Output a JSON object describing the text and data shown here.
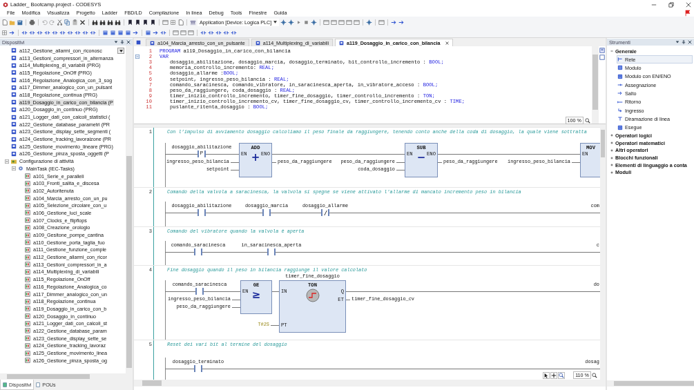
{
  "window": {
    "title": "Ladder_ Bootcamp.project - CODESYS"
  },
  "menu": [
    "File",
    "Modifica",
    "Visualizza",
    "Progetto",
    "Ladder",
    "FBD/LD",
    "Compilazione",
    "In linea",
    "Debug",
    "Tools",
    "Finestre",
    "Guida"
  ],
  "toolbar": {
    "application": "Application [Device: Logica PLC]"
  },
  "devices": {
    "title": "Dispositivi",
    "tree": [
      {
        "label": "a112_Gestione_allarmi_con_riconosc",
        "kind": "pou",
        "selected": false
      },
      {
        "label": "a113_Gestioni_compressori_in_alternanza",
        "kind": "pou",
        "selected": false
      },
      {
        "label": "a114_Multiplexing_di_variabili (PRG)",
        "kind": "pou",
        "selected": false
      },
      {
        "label": "a115_Regolazione_OnOff (PRG)",
        "kind": "pou",
        "selected": false
      },
      {
        "label": "a116_Regolazione_Analogica_con_3_sog",
        "kind": "pou",
        "selected": false
      },
      {
        "label": "a117_Dimmer_analogico_con_un_pulsant",
        "kind": "pou",
        "selected": false
      },
      {
        "label": "a118_Regolazione_continua (PRG)",
        "kind": "pou",
        "selected": false
      },
      {
        "label": "a119_Dosaggio_in_carico_con_bilancia (P",
        "kind": "pou",
        "selected": true
      },
      {
        "label": "a120_Dosaggio_in_continuo (PRG)",
        "kind": "pou",
        "selected": false
      },
      {
        "label": "a121_Logger_dati_con_calcoli_statistici (",
        "kind": "pou",
        "selected": false
      },
      {
        "label": "a122_Gestione_database_parametri (PR",
        "kind": "pou",
        "selected": false
      },
      {
        "label": "a123_Gestione_display_sette_segmenti (",
        "kind": "pou",
        "selected": false
      },
      {
        "label": "a124_Gestione_tracking_lavoraizone (PR",
        "kind": "pou",
        "selected": false
      },
      {
        "label": "a125_Gestione_movimento_lineare (PRG)",
        "kind": "pou",
        "selected": false
      },
      {
        "label": "a126_Gestione_pinza_sposta_oggetti (P",
        "kind": "pou",
        "selected": false
      },
      {
        "label": "Configurazione di attività",
        "kind": "task-config",
        "selected": false,
        "expanded": true,
        "children": [
          {
            "label": "MainTask (IEC-Tasks)",
            "kind": "task",
            "selected": false,
            "expanded": true,
            "children": [
              {
                "label": "a101_Serie_e_paralleli",
                "kind": "call",
                "selected": false
              },
              {
                "label": "a103_Fronti_salita_e_discesa",
                "kind": "call",
                "selected": false
              },
              {
                "label": "a102_Autoritenuta",
                "kind": "call",
                "selected": false
              },
              {
                "label": "a104_Marcia_arresto_con_un_pu",
                "kind": "call",
                "selected": false
              },
              {
                "label": "a105_Selezione_circolare_con_u",
                "kind": "call",
                "selected": false
              },
              {
                "label": "a106_Gestione_luci_scale",
                "kind": "call",
                "selected": false
              },
              {
                "label": "a107_Clocks_e_flipflops",
                "kind": "call",
                "selected": false
              },
              {
                "label": "a108_Creazione_orologio",
                "kind": "call",
                "selected": false
              },
              {
                "label": "a109_Gesitone_pompe_cantina",
                "kind": "call",
                "selected": false
              },
              {
                "label": "a110_Gestione_porta_taglia_fuo",
                "kind": "call",
                "selected": false
              },
              {
                "label": "a111_Gestione_funzione_comple",
                "kind": "call",
                "selected": false
              },
              {
                "label": "a112_Gestione_allarmi_con_ricor",
                "kind": "call",
                "selected": false
              },
              {
                "label": "a113_Gestioni_compressori_in_a",
                "kind": "call",
                "selected": false
              },
              {
                "label": "a114_Multiplexing_di_variabili",
                "kind": "call",
                "selected": false
              },
              {
                "label": "a115_Regolazione_OnOff",
                "kind": "call",
                "selected": false
              },
              {
                "label": "a116_Regolazione_Analogica_co",
                "kind": "call",
                "selected": false
              },
              {
                "label": "a117_Dimmer_analogico_con_un",
                "kind": "call",
                "selected": false
              },
              {
                "label": "a118_Regolazione_continua",
                "kind": "call",
                "selected": false
              },
              {
                "label": "a119_Dosaggio_in_carico_con_b",
                "kind": "call",
                "selected": false
              },
              {
                "label": "a120_Dosaggio_in_continuo",
                "kind": "call",
                "selected": false
              },
              {
                "label": "a121_Logger_dati_con_calcoli_st",
                "kind": "call",
                "selected": false
              },
              {
                "label": "a122_Gestione_database_param",
                "kind": "call",
                "selected": false
              },
              {
                "label": "a123_Gestione_display_sette_se",
                "kind": "call",
                "selected": false
              },
              {
                "label": "a124_Gestione_tracking_lavoraz",
                "kind": "call",
                "selected": false
              },
              {
                "label": "a125_Gestione_movimento_linea",
                "kind": "call",
                "selected": false
              },
              {
                "label": "a126_Gestione_pinza_sposta_og",
                "kind": "call",
                "selected": false
              }
            ]
          }
        ]
      }
    ]
  },
  "bottom_tabs": [
    {
      "label": "Dispositivi",
      "selected": true
    },
    {
      "label": "POUs",
      "selected": false
    }
  ],
  "editor_tabs": [
    {
      "label": "a104_Marcia_arresto_con_un_pulsante",
      "selected": false
    },
    {
      "label": "a114_Multiplexing_di_variabili",
      "selected": false
    },
    {
      "label": "a119_Dosaggio_in_carico_con_bilancia",
      "selected": true
    }
  ],
  "code": {
    "zoom": "100 %",
    "lines": [
      {
        "number": "1",
        "parts": [
          {
            "text": "PROGRAM",
            "kind": "keyword"
          },
          {
            "text": " a119_Dosaggio_in_carico_con_bilancia",
            "kind": "plain"
          }
        ]
      },
      {
        "number": "2",
        "parts": [
          {
            "text": "VAR",
            "kind": "keyword"
          }
        ],
        "expanded": true,
        "children": [
          {
            "number": "3",
            "parts": [
              {
                "text": "dosaggio_abilitazione, dosaggio_marcia, dosaggio_terminato, bit_controllo_incremento : ",
                "kind": "plain"
              },
              {
                "text": "BOOL;",
                "kind": "keyword"
              }
            ]
          },
          {
            "number": "4",
            "parts": [
              {
                "text": "memoria_controllo_incremento: ",
                "kind": "plain"
              },
              {
                "text": "REAL;",
                "kind": "keyword"
              }
            ]
          },
          {
            "number": "5",
            "parts": [
              {
                "text": "dosaggio_allarme :",
                "kind": "plain"
              },
              {
                "text": "BOOL;",
                "kind": "keyword"
              }
            ]
          },
          {
            "number": "6",
            "parts": [
              {
                "text": "setpoint, ingresso_peso_bilancia : ",
                "kind": "plain"
              },
              {
                "text": "REAL;",
                "kind": "keyword"
              }
            ]
          },
          {
            "number": "7",
            "parts": [
              {
                "text": "comando_saracinesca, comando_vibratore, in_saracinesca_aperta, in_vibratore_acceso : ",
                "kind": "plain"
              },
              {
                "text": "BOOL;",
                "kind": "keyword"
              }
            ]
          },
          {
            "number": "8",
            "parts": [
              {
                "text": "peso_da_raggiungere, coda_dosaggio : ",
                "kind": "plain"
              },
              {
                "text": "REAL;",
                "kind": "keyword"
              }
            ]
          },
          {
            "number": "9",
            "parts": [
              {
                "text": "timer_inizio_controllo_incremento, timer_fine_dosaggio, timer_controllo_incremento : ",
                "kind": "plain"
              },
              {
                "text": "TON;",
                "kind": "keyword"
              }
            ]
          },
          {
            "number": "10",
            "parts": [
              {
                "text": "timer_inizio_controllo_incremento_cv, timer_fine_dosaggio_cv, timer_controllo_incremento_cv : ",
                "kind": "plain"
              },
              {
                "text": "TIME;",
                "kind": "keyword"
              }
            ]
          },
          {
            "number": "11",
            "parts": [
              {
                "text": "puslante_ritenta_dosaggio : ",
                "kind": "plain"
              },
              {
                "text": "BOOL;",
                "kind": "keyword"
              }
            ]
          }
        ]
      }
    ]
  },
  "networks": [
    {
      "number": "1",
      "comment": "Con l’impulso di avviamento dosaggio calcoliamo il peso finale da raggiungere, tenendo conto anche della coda di dosaggio, la quale viene sottratta",
      "contacts": [
        {
          "label": "dosaggio_abilitazione",
          "kind": "rising",
          "edge": "P"
        }
      ],
      "blocks": [
        {
          "kind": "operator",
          "name": "ADD",
          "symbol": "+",
          "en": "EN",
          "eno": "ENO",
          "inputs": [
            "ingresso_peso_bilancia",
            "setpoint"
          ],
          "output": "peso_da_raggiungere"
        },
        {
          "kind": "operator",
          "name": "SUB",
          "symbol": "−",
          "en": "EN",
          "eno": "ENO",
          "inputs": [
            "peso_da_raggiungere",
            "coda_dosaggio"
          ],
          "output": "peso_da_raggiungere"
        },
        {
          "kind": "operator",
          "name": "MOV",
          "en": "EN",
          "inputs": [
            "ingresso_peso_bilancia"
          ]
        }
      ]
    },
    {
      "number": "2",
      "comment": "Comando della valvola a saracinesca, la valvola si spegne se viene attivato l'allarme di mancato incremento peso in bilancia",
      "contacts": [
        {
          "label": "dosaggio_abilitazione",
          "kind": "normal"
        },
        {
          "label": "dosaggio_marcia",
          "kind": "normal"
        },
        {
          "label": "dosaggio_allarme",
          "kind": "negated"
        }
      ],
      "coil_label": "com"
    },
    {
      "number": "3",
      "comment": "Comando del vibratore quando la valvola è aperta",
      "contacts": [
        {
          "label": "comando_saracinesca",
          "kind": "normal"
        },
        {
          "label": "in_saracinesca_aperta",
          "kind": "normal"
        }
      ],
      "coil_label": "c"
    },
    {
      "number": "4",
      "comment": "Fine dosaggio quando il peso in bilancia raggiunge il valore calcolato",
      "contacts": [
        {
          "label": "comando_saracinesca",
          "kind": "normal"
        }
      ],
      "blocks": [
        {
          "kind": "operator",
          "name": "GE",
          "symbol": "≥",
          "en": "EN",
          "inputs": [
            "ingresso_peso_bilancia",
            "peso_da_raggiungere"
          ]
        },
        {
          "kind": "timer",
          "name": "TON",
          "instance": "timer_fine_dosaggio",
          "inputs": [
            {
              "pin": "IN"
            },
            {
              "pin": "PT",
              "value": "T#2S"
            }
          ],
          "outputs": [
            {
              "pin": "Q"
            },
            {
              "pin": "ET",
              "value": "timer_fine_dosaggio_cv"
            }
          ]
        }
      ],
      "coil_label": "do"
    },
    {
      "number": "5",
      "comment": "Reset dei vari bit al termine del dosaggio",
      "contacts": [
        {
          "label": "dosaggio_terminato",
          "kind": "normal"
        }
      ],
      "coil_label": "dosag"
    }
  ],
  "ladder_zoom": "110 %",
  "tools": {
    "title": "Strumenti",
    "groups": [
      {
        "label": "Generale",
        "expanded": true,
        "children": [
          {
            "label": "Rete",
            "kind": "network",
            "selected": true
          },
          {
            "label": "Modulo",
            "kind": "block",
            "selected": false
          },
          {
            "label": "Modulo con EN/ENO",
            "kind": "block-en",
            "selected": false
          },
          {
            "label": "Assegnazione",
            "kind": "assign",
            "selected": false
          },
          {
            "label": "Salto",
            "kind": "jump",
            "selected": false
          },
          {
            "label": "Ritorno",
            "kind": "return",
            "selected": false
          },
          {
            "label": "Ingresso",
            "kind": "input",
            "selected": false
          },
          {
            "label": "Diramazione di linea",
            "kind": "branch",
            "selected": false
          },
          {
            "label": "Esegue",
            "kind": "execute",
            "selected": false
          }
        ]
      },
      {
        "label": "Operatori logici",
        "expanded": false
      },
      {
        "label": "Operatori matematici",
        "expanded": false
      },
      {
        "label": "Altri operatori",
        "expanded": false
      },
      {
        "label": "Blocchi funzionali",
        "expanded": false
      },
      {
        "label": "Elementi di linguaggio a conta",
        "expanded": false
      },
      {
        "label": "Moduli",
        "expanded": false
      }
    ]
  }
}
